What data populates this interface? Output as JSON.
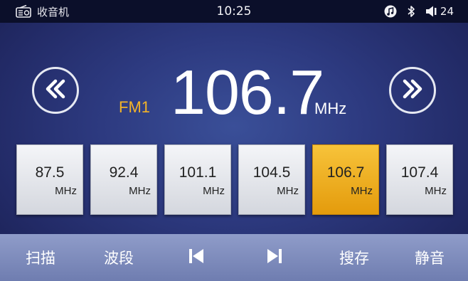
{
  "status_bar": {
    "app_icon": "radio-icon",
    "app_label": "收音机",
    "clock": "10:25",
    "icons": [
      "music-note-icon",
      "bluetooth-icon",
      "speaker-icon"
    ],
    "volume": "24"
  },
  "tuner": {
    "band": "FM1",
    "frequency": "106.7",
    "unit": "MHz",
    "prev_icon": "double-chevron-left-icon",
    "next_icon": "double-chevron-right-icon"
  },
  "presets": [
    {
      "value": "87.5",
      "unit": "MHz",
      "active": false
    },
    {
      "value": "92.4",
      "unit": "MHz",
      "active": false
    },
    {
      "value": "101.1",
      "unit": "MHz",
      "active": false
    },
    {
      "value": "104.5",
      "unit": "MHz",
      "active": false
    },
    {
      "value": "106.7",
      "unit": "MHz",
      "active": true
    },
    {
      "value": "107.4",
      "unit": "MHz",
      "active": false
    }
  ],
  "bottom_bar": {
    "scan": "扫描",
    "band": "波段",
    "prev_icon": "skip-previous-icon",
    "next_icon": "skip-next-icon",
    "store": "搜存",
    "mute": "静音"
  },
  "colors": {
    "accent": "#f2b328",
    "preset_active": "#eeaa1c",
    "background": "#2d3a80",
    "status_bar": "#0b0f2a",
    "bottom_bar": "#8592c0"
  }
}
